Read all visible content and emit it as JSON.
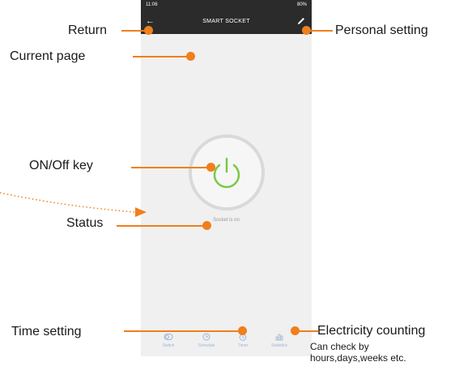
{
  "colors": {
    "accent": "#f07f1c",
    "app_bar": "#2b2b2b",
    "power_ring": "#7ac943",
    "tab": "#9fb3d9"
  },
  "statusbar": {
    "time": "11:06",
    "system": "80%"
  },
  "app": {
    "title": "SMART SOCKET",
    "back_icon": "arrow-left-icon",
    "edit_icon": "pencil-icon"
  },
  "socket": {
    "status": "Socket is on",
    "power_icon": "power-icon"
  },
  "tabs": [
    {
      "label": "Switch",
      "icon": "switch-icon"
    },
    {
      "label": "Schedule",
      "icon": "clock-icon"
    },
    {
      "label": "Timer",
      "icon": "timer-icon"
    },
    {
      "label": "Statistics",
      "icon": "bar-chart-icon"
    }
  ],
  "annotations": {
    "return": "Return",
    "personal_setting": "Personal setting",
    "current_page": "Current page",
    "onoff_key": "ON/Off key",
    "status": "Status",
    "time_setting": "Time setting",
    "electricity_counting": "Electricity counting",
    "electricity_note_1": "Can check by",
    "electricity_note_2": "hours,days,weeks etc."
  }
}
